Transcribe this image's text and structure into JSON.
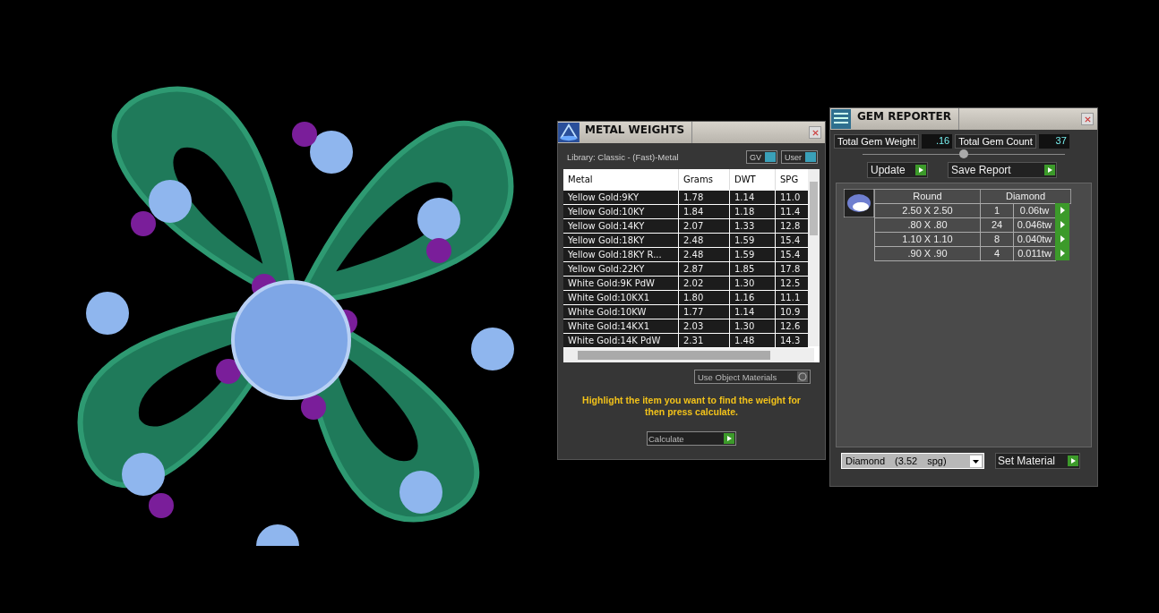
{
  "metal_weights": {
    "title": "METAL WEIGHTS",
    "library": "Library: Classic - (Fast)-Metal",
    "toggles": [
      {
        "label": "GV",
        "on": true
      },
      {
        "label": "User",
        "on": true
      }
    ],
    "table": {
      "columns": [
        "Metal",
        "Grams",
        "DWT",
        "SPG"
      ],
      "rows": [
        [
          "Yellow Gold:9KY",
          "1.78",
          "1.14",
          "11.0"
        ],
        [
          "Yellow Gold:10KY",
          "1.84",
          "1.18",
          "11.4"
        ],
        [
          "Yellow Gold:14KY",
          "2.07",
          "1.33",
          "12.8"
        ],
        [
          "Yellow Gold:18KY",
          "2.48",
          "1.59",
          "15.4"
        ],
        [
          "Yellow Gold:18KY R...",
          "2.48",
          "1.59",
          "15.4"
        ],
        [
          "Yellow Gold:22KY",
          "2.87",
          "1.85",
          "17.8"
        ],
        [
          "White Gold:9K PdW",
          "2.02",
          "1.30",
          "12.5"
        ],
        [
          "White Gold:10KX1",
          "1.80",
          "1.16",
          "11.1"
        ],
        [
          "White Gold:10KW",
          "1.77",
          "1.14",
          "10.9"
        ],
        [
          "White Gold:14KX1",
          "2.03",
          "1.30",
          "12.6"
        ],
        [
          "White Gold:14K PdW",
          "2.31",
          "1.48",
          "14.3"
        ]
      ]
    },
    "use_object_materials": "Use Object Materials",
    "hint": "Highlight the item you want to find the weight for then press calculate.",
    "calculate": "Calculate"
  },
  "gem_reporter": {
    "title": "GEM REPORTER",
    "total_weight_label": "Total Gem Weight",
    "total_weight": ".16",
    "total_count_label": "Total Gem Count",
    "total_count": "37",
    "buttons": [
      "Update",
      "Save Report"
    ],
    "list_header": {
      "shape": "Round",
      "material": "Diamond"
    },
    "table": {
      "rows": [
        [
          "2.50 X 2.50",
          "1",
          "0.06tw"
        ],
        [
          ".80 X .80",
          "24",
          "0.046tw"
        ],
        [
          "1.10 X 1.10",
          "8",
          "0.040tw"
        ],
        [
          ".90 X .90",
          "4",
          "0.011tw"
        ]
      ]
    },
    "material": "Diamond (3.52 spg)",
    "set_material": "Set Material"
  }
}
